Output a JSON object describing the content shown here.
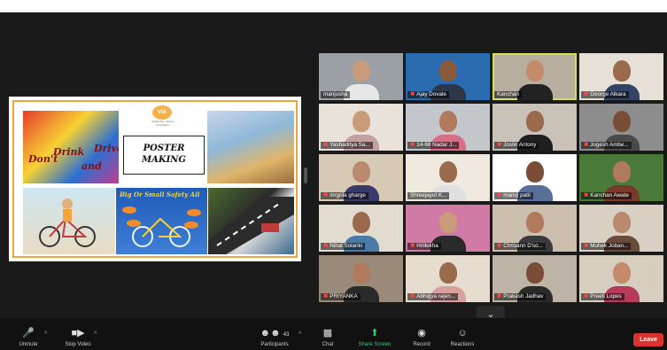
{
  "window": {
    "title": ""
  },
  "share": {
    "logo_text": "VIA",
    "logo_subtitle": "Global Sec. School Foundation",
    "poster_title_line1": "POSTER",
    "poster_title_line2": "MAKING",
    "tile1_words": [
      "Don't",
      "Drink",
      "and",
      "Drive"
    ],
    "tile4_text": "Big Or Small Safety All"
  },
  "participants": [
    {
      "name": "manjusha",
      "muted": false,
      "skin": "#c99b7a",
      "shirt": "#e6e6e6",
      "bg": "#9aa0a6"
    },
    {
      "name": "Ajay Dovale",
      "muted": true,
      "skin": "#8a5a3c",
      "shirt": "#2d3748",
      "bg": "#2b6cb0"
    },
    {
      "name": "Kanchan",
      "muted": false,
      "skin": "#c58a6a",
      "shirt": "#222222",
      "bg": "#b7aea0",
      "active": true
    },
    {
      "name": "George Alkara",
      "muted": true,
      "skin": "#9a6a4c",
      "shirt": "#334466",
      "bg": "#e6e0d6"
    },
    {
      "name": "Yashaditya Sa...",
      "muted": true,
      "skin": "#c99b7a",
      "shirt": "#c5a0a0",
      "bg": "#e8e2da"
    },
    {
      "name": "14-66 Nadar J...",
      "muted": true,
      "skin": "#b07a5c",
      "shirt": "#d86f87",
      "bg": "#c3c7cc"
    },
    {
      "name": "Joslin Antony",
      "muted": true,
      "skin": "#9a6a4c",
      "shirt": "#1f1f1f",
      "bg": "#c8c2b8"
    },
    {
      "name": "Jogesh Ambe...",
      "muted": true,
      "skin": "#7a4e36",
      "shirt": "#4a4a4a",
      "bg": "#8d8d8d"
    },
    {
      "name": "mrgrila gharge",
      "muted": true,
      "skin": "#b98a6e",
      "shirt": "#3a3a6a",
      "bg": "#d6c9b6"
    },
    {
      "name": "Shreejayut K...",
      "muted": false,
      "skin": "#9a6a4c",
      "shirt": "#e0e0e0",
      "bg": "#efe9df"
    },
    {
      "name": "manoj patil",
      "muted": true,
      "skin": "#7a4e36",
      "shirt": "#5a6e9a",
      "bg": "#ffffff"
    },
    {
      "name": "Kanchan Awate",
      "muted": true,
      "skin": "#b07a5c",
      "shirt": "#7a3a2a",
      "bg": "#4a7a3a"
    },
    {
      "name": "Nihal Solanki",
      "muted": true,
      "skin": "#9a6a4c",
      "shirt": "#4a7aa6",
      "bg": "#e2dbd0"
    },
    {
      "name": "Hrillekha",
      "muted": true,
      "skin": "#c99b7a",
      "shirt": "#2a2a2a",
      "bg": "#d07aa6"
    },
    {
      "name": "Chrisann D'so...",
      "muted": true,
      "skin": "#b07a5c",
      "shirt": "#3a3a3a",
      "bg": "#cdbfae"
    },
    {
      "name": "Mohek Joban...",
      "muted": true,
      "skin": "#b98a6e",
      "shirt": "#6a4a3a",
      "bg": "#d9cfc2"
    },
    {
      "name": "PRIYANKA",
      "muted": true,
      "skin": "#b07a5c",
      "shirt": "#2a2a2a",
      "bg": "#9a8a7a"
    },
    {
      "name": "Abhigya rajen...",
      "muted": true,
      "skin": "#9a6a4c",
      "shirt": "#d9a0a0",
      "bg": "#e6dccf"
    },
    {
      "name": "Prakash Jadhav",
      "muted": true,
      "skin": "#7a4e36",
      "shirt": "#2a2a2a",
      "bg": "#bdb3a6"
    },
    {
      "name": "Preeti Lopes",
      "muted": true,
      "skin": "#c58a6a",
      "shirt": "#b83a5a",
      "bg": "#d8cec0"
    }
  ],
  "toolbar": {
    "unmute": "Unmute",
    "stop_video": "Stop Video",
    "participants": "Participants",
    "participants_count": "43",
    "chat": "Chat",
    "share_screen": "Share Screen",
    "record": "Record",
    "reactions": "Reactions",
    "leave": "Leave"
  },
  "icons": {
    "unmute": "microphone-muted-icon",
    "stop_video": "video-camera-icon",
    "participants": "people-icon",
    "chat": "chat-bubble-icon",
    "share_screen": "share-arrow-icon",
    "record": "record-dot-icon",
    "reactions": "smiley-icon",
    "scroll": "chevron-down-icon"
  },
  "colors": {
    "accent_green": "#2fd36a",
    "leave_red": "#d9322f",
    "active_border": "#d6e04a"
  }
}
